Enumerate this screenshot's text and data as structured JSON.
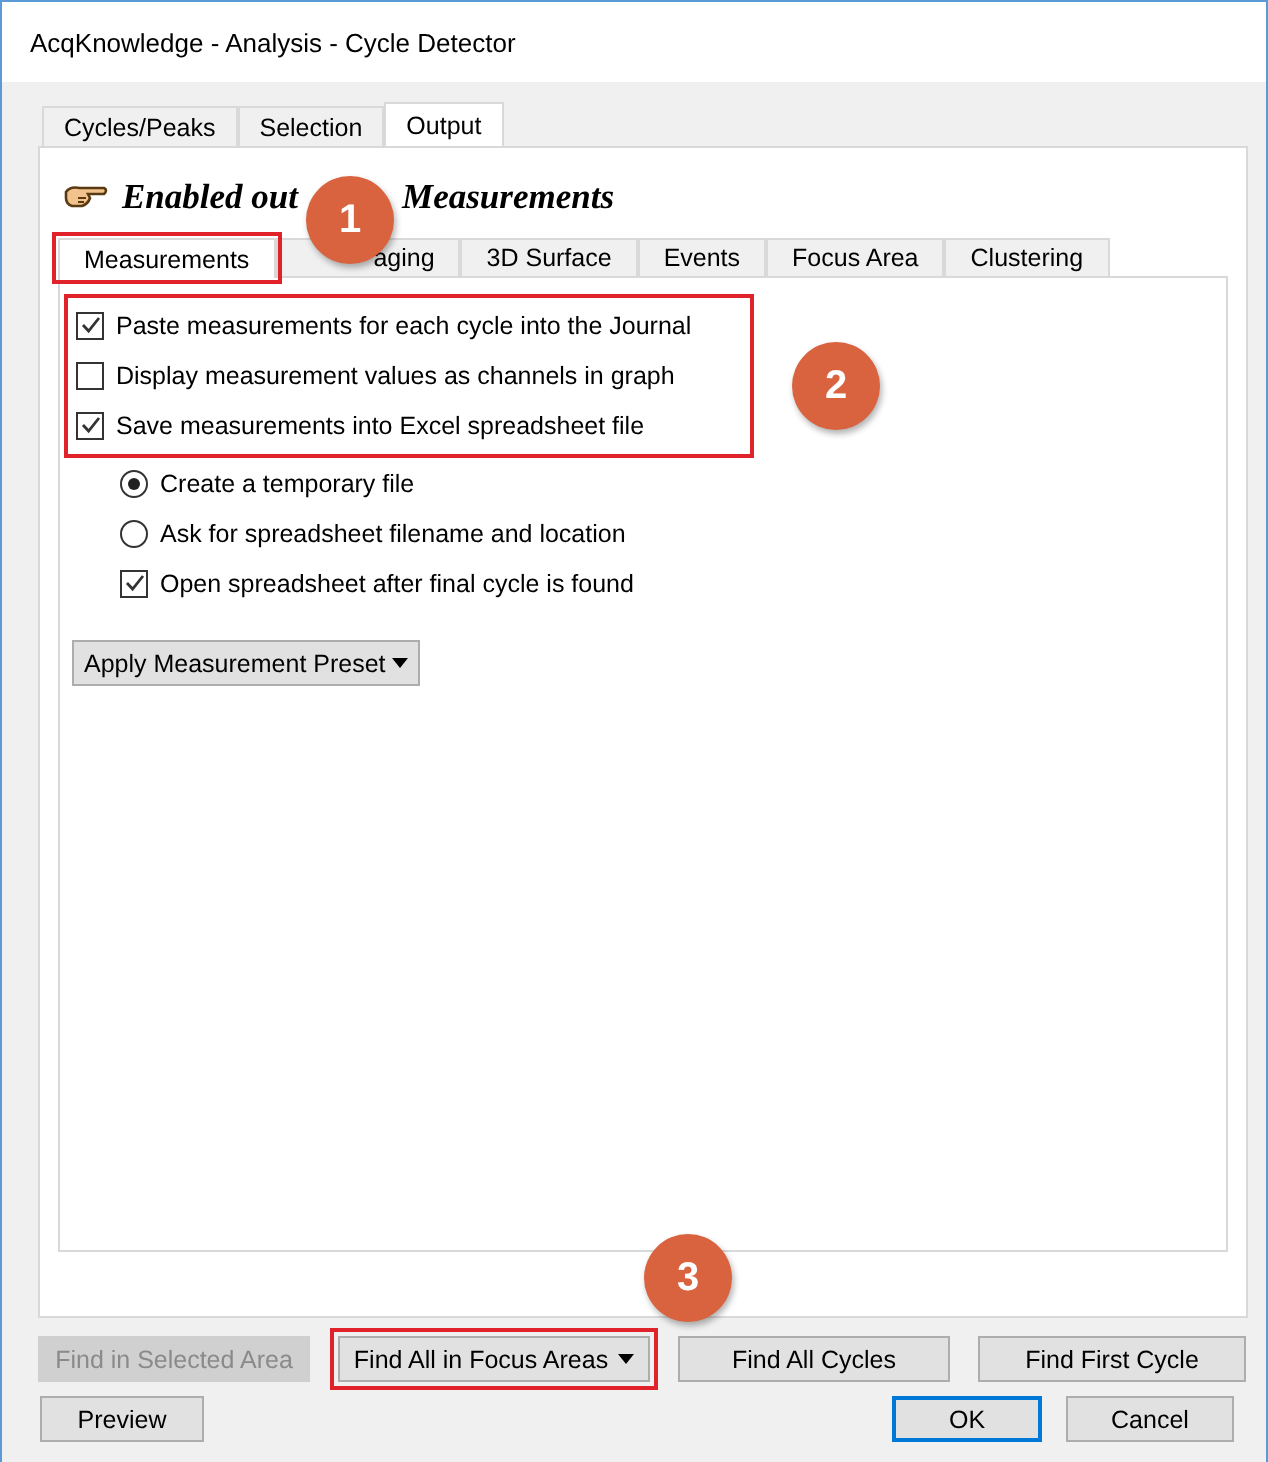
{
  "window": {
    "title": "AcqKnowledge - Analysis - Cycle Detector"
  },
  "tabs": [
    {
      "label": "Cycles/Peaks",
      "selected": false
    },
    {
      "label": "Selection",
      "selected": false
    },
    {
      "label": "Output",
      "selected": true
    }
  ],
  "heading": {
    "before": "Enabled out",
    "after": "Measurements"
  },
  "subtabs": [
    {
      "label": "Measurements",
      "selected": true,
      "highlighted": true
    },
    {
      "label": "aging",
      "selected": false,
      "highlighted": false
    },
    {
      "label": "3D Surface",
      "selected": false,
      "highlighted": false
    },
    {
      "label": "Events",
      "selected": false,
      "highlighted": false
    },
    {
      "label": "Focus Area",
      "selected": false,
      "highlighted": false
    },
    {
      "label": "Clustering",
      "selected": false,
      "highlighted": false
    }
  ],
  "options": [
    {
      "kind": "checkbox",
      "label": "Paste measurements for each cycle into the Journal",
      "checked": true
    },
    {
      "kind": "checkbox",
      "label": "Display measurement values as channels in graph",
      "checked": false
    },
    {
      "kind": "checkbox",
      "label": "Save measurements into Excel spreadsheet file",
      "checked": true
    }
  ],
  "suboptions": [
    {
      "kind": "radio",
      "label": "Create a temporary file",
      "selected": true
    },
    {
      "kind": "radio",
      "label": "Ask for spreadsheet filename and location",
      "selected": false
    },
    {
      "kind": "checkbox",
      "label": "Open spreadsheet after final cycle is found",
      "checked": true
    }
  ],
  "preset_button": "Apply Measurement Preset",
  "find_buttons": [
    {
      "label": "Find in Selected Area",
      "disabled": true,
      "dropdown": false,
      "highlighted": false
    },
    {
      "label": "Find All in Focus Areas",
      "disabled": false,
      "dropdown": true,
      "highlighted": true
    },
    {
      "label": "Find All Cycles",
      "disabled": false,
      "dropdown": false,
      "highlighted": false
    },
    {
      "label": "Find First Cycle",
      "disabled": false,
      "dropdown": false,
      "highlighted": false
    }
  ],
  "bottom_buttons": [
    {
      "label": "Preview",
      "default": false
    },
    {
      "label": "OK",
      "default": true
    },
    {
      "label": "Cancel",
      "default": false
    }
  ],
  "callouts": [
    "1",
    "2",
    "3"
  ]
}
